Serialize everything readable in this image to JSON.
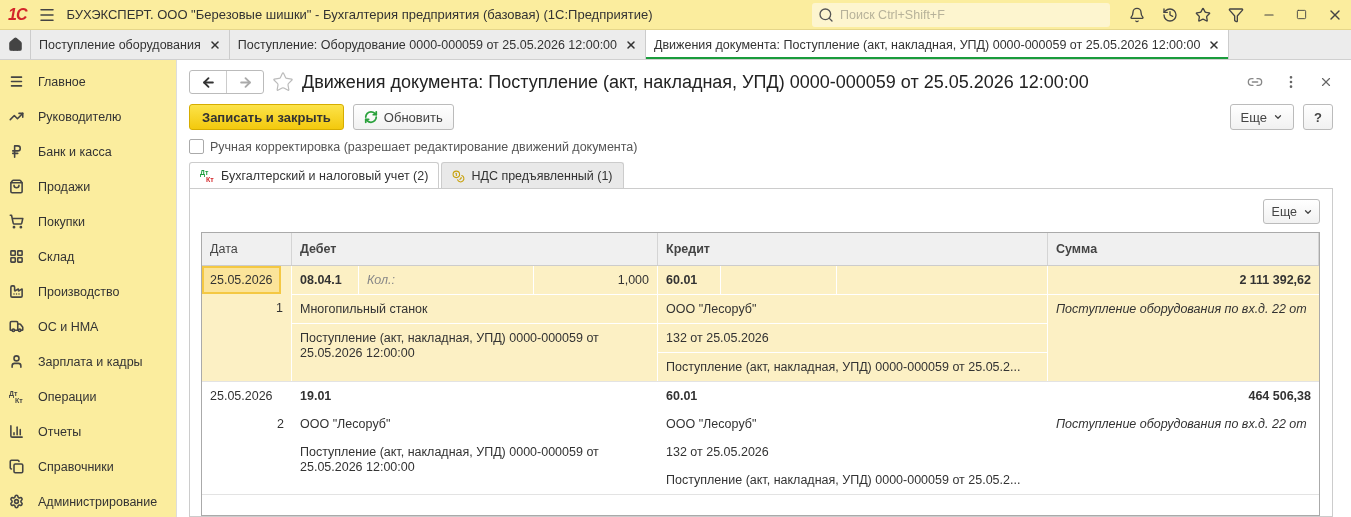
{
  "app_bar": {
    "logo": "1С",
    "title": "БУХЭКСПЕРТ. ООО \"Березовые шишки\" - Бухгалтерия предприятия (базовая)  (1С:Предприятие)",
    "search": {
      "placeholder": "Поиск Ctrl+Shift+F"
    }
  },
  "open_tabs": [
    {
      "label": "Поступление оборудования",
      "selected": false
    },
    {
      "label": "Поступление: Оборудование 0000-000059 от 25.05.2026 12:00:00",
      "selected": false
    },
    {
      "label": "Движения документа: Поступление (акт, накладная, УПД) 0000-000059 от 25.05.2026 12:00:00",
      "selected": true
    }
  ],
  "sidebar": {
    "items": [
      {
        "label": "Главное"
      },
      {
        "label": "Руководителю"
      },
      {
        "label": "Банк и касса"
      },
      {
        "label": "Продажи"
      },
      {
        "label": "Покупки"
      },
      {
        "label": "Склад"
      },
      {
        "label": "Производство"
      },
      {
        "label": "ОС и НМА"
      },
      {
        "label": "Зарплата и кадры"
      },
      {
        "label": "Операции",
        "icon_text": [
          "Дт",
          "Кт"
        ]
      },
      {
        "label": "Отчеты"
      },
      {
        "label": "Справочники"
      },
      {
        "label": "Администрирование"
      }
    ]
  },
  "form": {
    "title": "Движения документа: Поступление (акт, накладная, УПД) 0000-000059 от 25.05.2026 12:00:00",
    "save_button": "Записать и закрыть",
    "refresh_button": "Обновить",
    "more_button": "Еще",
    "help_button": "?",
    "manual_edit": {
      "label": "Ручная корректировка (разрешает редактирование движений документа)",
      "checked": false
    },
    "tabs": [
      {
        "label": "Бухгалтерский и налоговый учет (2)",
        "selected": true,
        "icon_text": [
          "Дт",
          "Кт"
        ]
      },
      {
        "label": "НДС предъявленный (1)",
        "selected": false
      }
    ],
    "table_more_button": "Еще",
    "table": {
      "columns": [
        "Дата",
        "Дебет",
        "Кредит",
        "Сумма"
      ],
      "entries": [
        {
          "selected": true,
          "date": "25.05.2026",
          "number": "1",
          "debit": {
            "account": "08.04.1",
            "quantity_label": "Кол.:",
            "quantity": "1,000",
            "lines": [
              "Многопильный станок",
              "Поступление (акт, накладная, УПД) 0000-000059 от 25.05.2026 12:00:00"
            ]
          },
          "credit": {
            "account": "60.01",
            "lines": [
              "ООО \"Лесоруб\"",
              "132 от 25.05.2026",
              "Поступление (акт, накладная, УПД) 0000-000059 от 25.05.2..."
            ]
          },
          "amount": "2 111 392,62",
          "description": "Поступление оборудования по вх.д. 22 от"
        },
        {
          "selected": false,
          "date": "25.05.2026",
          "number": "2",
          "debit": {
            "account": "19.01",
            "lines": [
              "ООО \"Лесоруб\"",
              "Поступление (акт, накладная, УПД) 0000-000059 от 25.05.2026 12:00:00"
            ]
          },
          "credit": {
            "account": "60.01",
            "lines": [
              "ООО \"Лесоруб\"",
              "132 от 25.05.2026",
              "Поступление (акт, накладная, УПД) 0000-000059 от 25.05.2..."
            ]
          },
          "amount": "464 506,38",
          "description": "Поступление оборудования по вх.д. 22 от"
        }
      ]
    }
  }
}
